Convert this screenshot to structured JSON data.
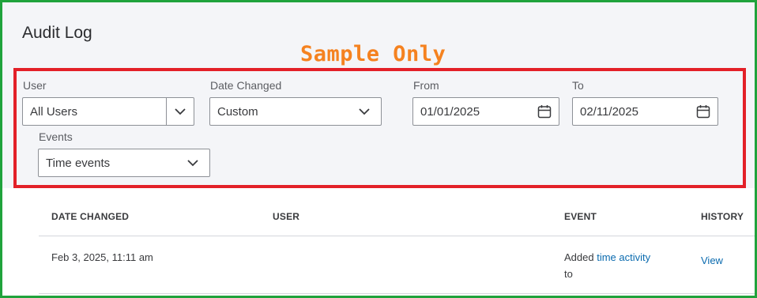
{
  "page": {
    "title": "Audit Log"
  },
  "watermark": "Sample Only",
  "filters": {
    "user": {
      "label": "User",
      "value": "All Users"
    },
    "date_changed": {
      "label": "Date Changed",
      "value": "Custom"
    },
    "from": {
      "label": "From",
      "value": "01/01/2025"
    },
    "to": {
      "label": "To",
      "value": "02/11/2025"
    },
    "events": {
      "label": "Events",
      "value": "Time events"
    }
  },
  "table": {
    "columns": [
      "DATE CHANGED",
      "USER",
      "EVENT",
      "HISTORY"
    ],
    "rows": [
      {
        "date_changed": "Feb 3, 2025, 11:11 am",
        "user": "",
        "event_prefix": "Added",
        "event_link": "time activity",
        "event_suffix": "to",
        "history": "View"
      }
    ]
  },
  "colors": {
    "frame": "#20a33c",
    "highlight": "#e32028",
    "watermark": "#f58220",
    "link": "#0b6baf"
  },
  "icons": [
    "chevron-down-icon",
    "calendar-icon"
  ]
}
